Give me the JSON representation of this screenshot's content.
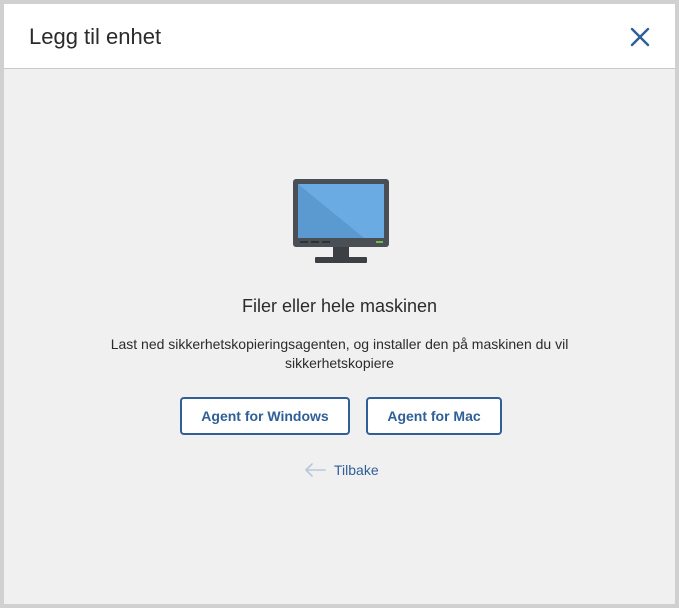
{
  "dialog": {
    "title": "Legg til enhet"
  },
  "content": {
    "icon": "monitor-icon",
    "heading": "Filer eller hele maskinen",
    "description": "Last ned sikkerhetskopieringsagenten, og installer den på maskinen du vil sikkerhetskopiere"
  },
  "buttons": {
    "windows_label": "Agent for Windows",
    "mac_label": "Agent for Mac"
  },
  "back": {
    "label": "Tilbake"
  },
  "colors": {
    "accent": "#2f5f96",
    "monitor_frame": "#4a4f55",
    "screen": "#6aabe3",
    "indicator": "#6ec04d"
  }
}
